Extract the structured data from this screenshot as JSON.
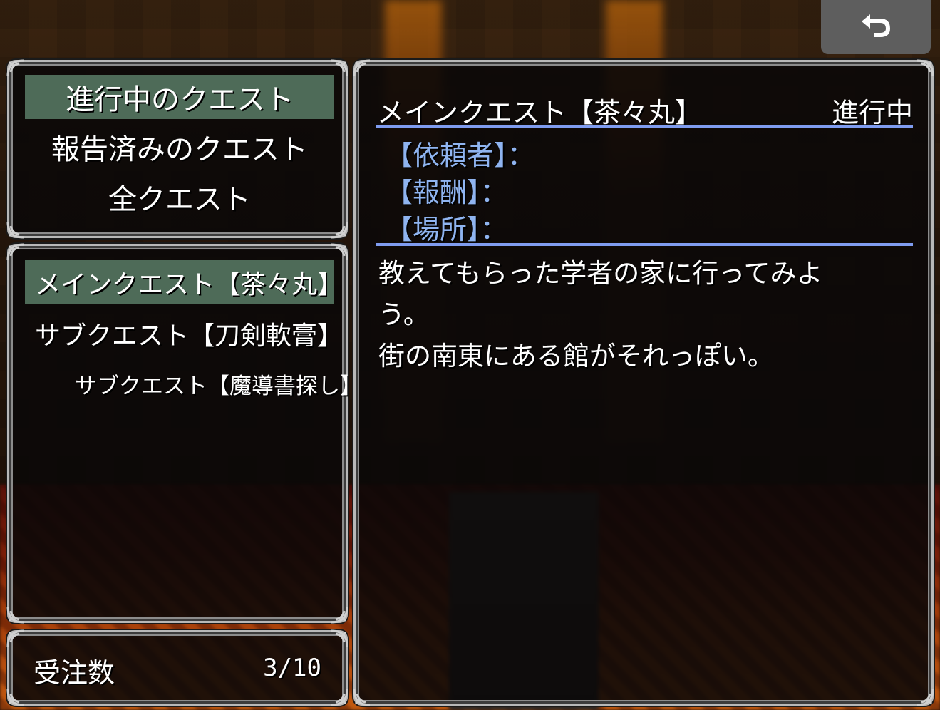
{
  "categories": {
    "items": [
      {
        "label": "進行中のクエスト",
        "selected": true
      },
      {
        "label": "報告済みのクエスト",
        "selected": false
      },
      {
        "label": "全クエスト",
        "selected": false
      }
    ]
  },
  "quest_list": {
    "items": [
      {
        "label": "メインクエスト【茶々丸】",
        "selected": true
      },
      {
        "label": "サブクエスト【刀剣軟膏】",
        "selected": false
      },
      {
        "label": "サブクエスト【魔導書探し】",
        "selected": false
      }
    ]
  },
  "counter": {
    "label": "受注数",
    "value": "3/10"
  },
  "detail": {
    "title": "メインクエスト【茶々丸】",
    "status": "進行中",
    "fields": [
      {
        "label": "【依頼者】：",
        "value": ""
      },
      {
        "label": "【報酬】：",
        "value": ""
      },
      {
        "label": "【場所】：",
        "value": ""
      }
    ],
    "description": [
      "教えてもらった学者の家に行ってみよ",
      "う。",
      "街の南東にある館がそれっぽい。"
    ]
  },
  "back_button": {
    "icon": "back-arrow-icon"
  },
  "colors": {
    "selection": "#4e6b58",
    "rule": "#7f9cf0",
    "field_label": "#8fb4f0",
    "window_bg": "#0a0808"
  }
}
